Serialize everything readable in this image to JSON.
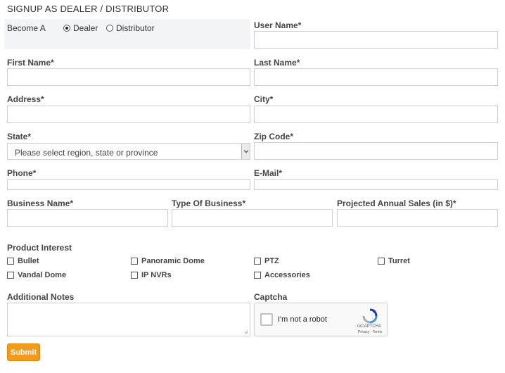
{
  "form": {
    "title": "SIGNUP AS DEALER / DISTRIBUTOR",
    "become_a": {
      "label": "Become A",
      "options": [
        {
          "label": "Dealer",
          "checked": true
        },
        {
          "label": "Distributor",
          "checked": false
        }
      ]
    },
    "fields": {
      "user_name": "User Name*",
      "first_name": "First Name*",
      "last_name": "Last Name*",
      "address": "Address*",
      "city": "City*",
      "state": "State*",
      "state_placeholder": "Please select region, state or province",
      "zip_code": "Zip Code*",
      "phone": "Phone*",
      "email": "E-Mail*",
      "business_name": "Business Name*",
      "type_of_business": "Type Of Business*",
      "projected_sales": "Projected Annual Sales (in $)*"
    },
    "product_interest": {
      "label": "Product Interest",
      "options": [
        "Bullet",
        "Panoramic Dome",
        "PTZ",
        "Turret",
        "Vandal Dome",
        "IP NVRs",
        "Accessories"
      ]
    },
    "additional_notes": "Additional Notes",
    "captcha": {
      "label": "Captcha",
      "checkbox_text": "I'm not a robot",
      "brand": "reCAPTCHA",
      "terms": "Privacy - Terms"
    },
    "submit_label": "Submit"
  },
  "colors": {
    "accent": "#f39a1e",
    "border": "#cfcfcf",
    "panel": "#f3f4f6"
  }
}
